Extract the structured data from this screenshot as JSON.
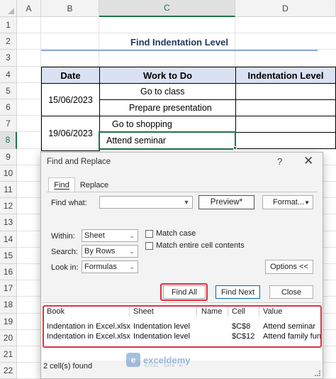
{
  "sheet": {
    "columns": [
      "A",
      "B",
      "C",
      "D"
    ],
    "rows": [
      "1",
      "2",
      "3",
      "4",
      "5",
      "6",
      "7",
      "8",
      "9",
      "10",
      "11",
      "12",
      "13",
      "14",
      "15",
      "16",
      "17",
      "18",
      "19",
      "20",
      "21",
      "22"
    ],
    "title": "Find Indentation Level",
    "table": {
      "headers": [
        "Date",
        "Work to Do",
        "Indentation Level"
      ],
      "dates": [
        "15/06/2023",
        "19/06/2023"
      ],
      "tasks": [
        "Go to class",
        "Prepare presentation",
        "Go to shopping",
        "Attend seminar"
      ]
    }
  },
  "dialog": {
    "title": "Find and Replace",
    "help": "?",
    "close": "✕",
    "tabs": [
      "Find",
      "Replace"
    ],
    "find_what_label": "Find what:",
    "find_what_value": "",
    "preview_label": "Preview*",
    "format_label": "Format...",
    "within_label": "Within:",
    "within_value": "Sheet",
    "search_label": "Search:",
    "search_value": "By Rows",
    "lookin_label": "Look in:",
    "lookin_value": "Formulas",
    "match_case_label": "Match case",
    "match_entire_label": "Match entire cell contents",
    "options_label": "Options <<",
    "find_all_label": "Find All",
    "find_next_label": "Find Next",
    "close_label": "Close",
    "results": {
      "headers": [
        "Book",
        "Sheet",
        "Name",
        "Cell",
        "Value"
      ],
      "rows": [
        [
          "Indentation in Excel.xlsx",
          "Indentation level",
          "",
          "$C$8",
          "Attend seminar"
        ],
        [
          "Indentation in Excel.xlsx",
          "Indentation level",
          "",
          "$C$12",
          "Attend family func"
        ]
      ]
    },
    "status": "2 cell(s) found"
  },
  "watermark": {
    "name": "exceldemy",
    "tagline": "EXCEL · DATA · BI"
  },
  "colors": {
    "accent_green": "#217346",
    "highlight_red": "#e0313e",
    "header_fill": "#d9e1f2",
    "title_blue": "#1f3864"
  }
}
